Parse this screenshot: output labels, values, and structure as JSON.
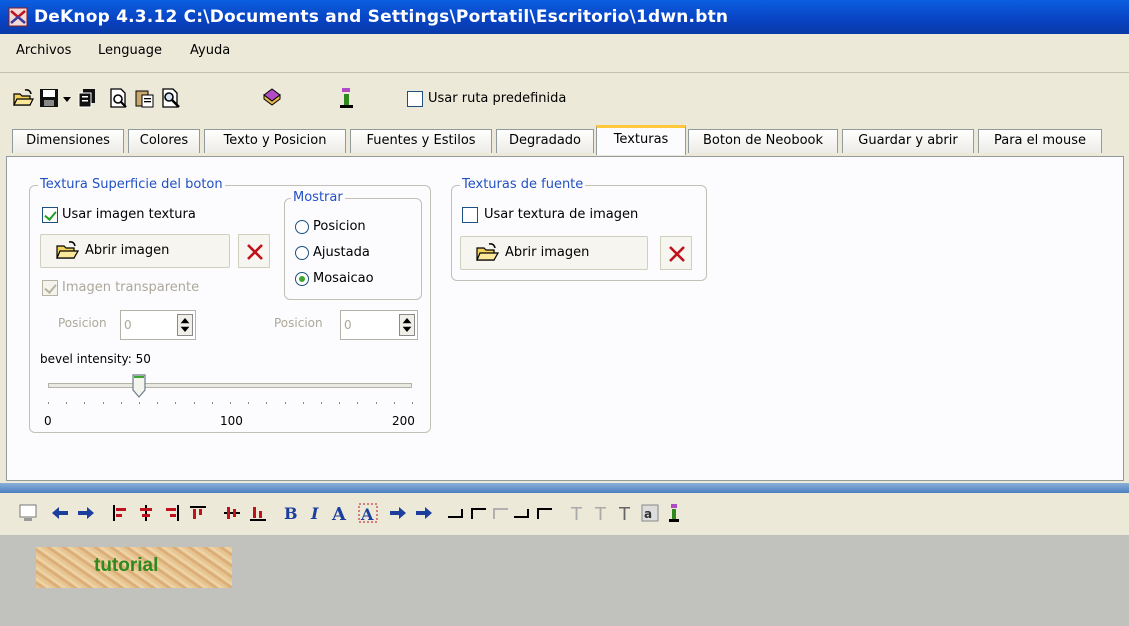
{
  "window": {
    "title": "DeKnop 4.3.12 C:\\Documents and Settings\\Portatil\\Escritorio\\1dwn.btn"
  },
  "menu": {
    "items": [
      "Archivos",
      "Lenguage",
      "Ayuda"
    ]
  },
  "toolbar": {
    "icons": [
      "open-folder-icon",
      "save-icon",
      "dropdown-arrow-icon",
      "copy-pages-icon",
      "print-preview-icon",
      "clipboard-icon",
      "search-document-icon",
      "book-icon",
      "info-icon"
    ],
    "usar_ruta_label": "Usar ruta predefinida",
    "usar_ruta_checked": false
  },
  "tabs": [
    "Dimensiones",
    "Colores",
    "Texto y Posicion",
    "Fuentes y Estilos",
    "Degradado",
    "Texturas",
    "Boton de Neobook",
    "Guardar y abrir",
    "Para el mouse"
  ],
  "active_tab": "Texturas",
  "surface": {
    "group_label": "Textura Superficie del boton",
    "use_texture_label": "Usar imagen textura",
    "use_texture_checked": true,
    "open_image_label": "Abrir imagen",
    "transparent_label": "Imagen transparente",
    "transparent_checked": true,
    "mostrar": {
      "label": "Mostrar",
      "options": [
        "Posicion",
        "Ajustada",
        "Mosaicao"
      ],
      "selected": "Mosaicao"
    },
    "pos1_label": "Posicion",
    "pos1_value": "0",
    "pos2_label": "Posicion",
    "pos2_value": "0",
    "bevel_label": "bevel intensity: 50",
    "bevel_value": 50,
    "bevel_min": "0",
    "bevel_mid": "100",
    "bevel_max": "200"
  },
  "font_texture": {
    "group_label": "Texturas de fuente",
    "use_label": "Usar textura de imagen",
    "use_checked": false,
    "open_image_label": "Abrir imagen"
  },
  "preview": {
    "text": "tutorial"
  },
  "colors": {
    "title_blue": "#0842c2",
    "accent_tab": "#ffc83c",
    "group_label_blue": "#2251c3",
    "preview_text": "#2e8a1f",
    "delete_red": "#c0121d"
  }
}
